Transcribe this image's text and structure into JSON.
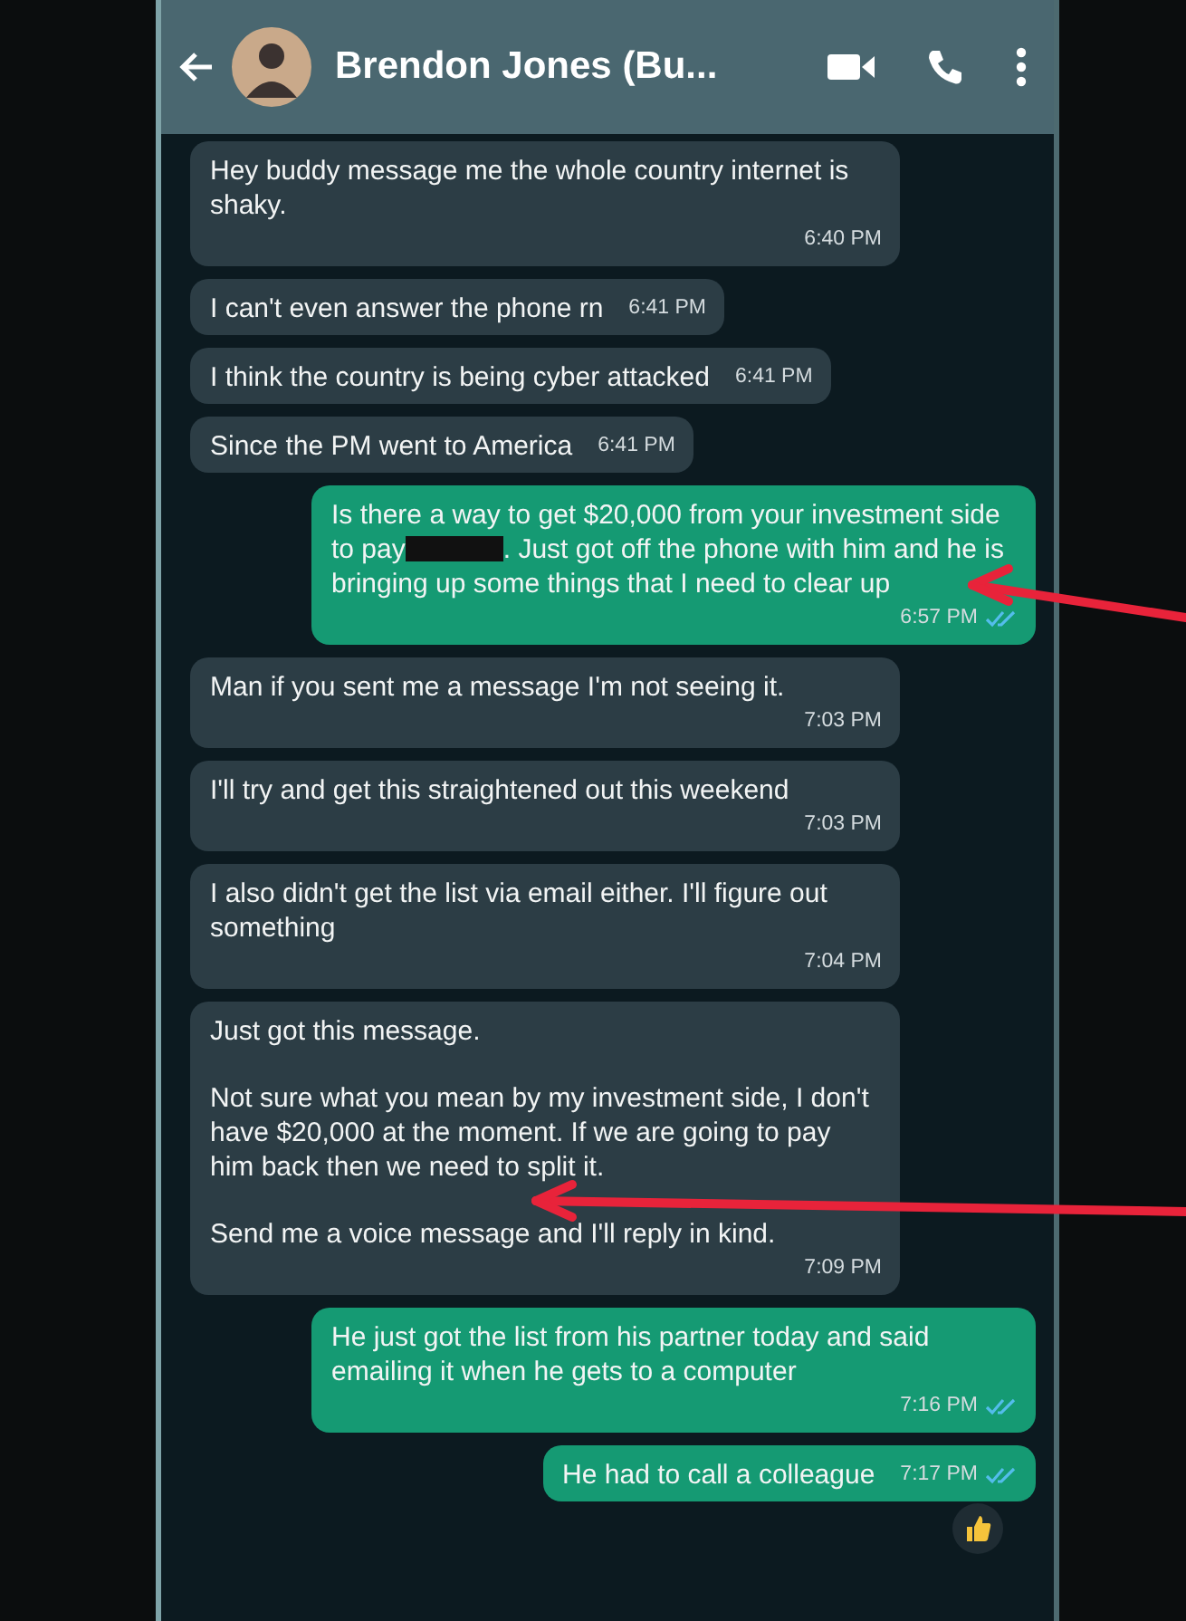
{
  "header": {
    "contact_name": "Brendon Jones (Bu..."
  },
  "messages": [
    {
      "kind": "incoming",
      "parts": [
        {
          "kind": "text",
          "text": "Hey buddy message me the whole country internet is shaky."
        }
      ],
      "time": "6:40 PM"
    },
    {
      "kind": "incoming",
      "parts": [
        {
          "kind": "text",
          "text": "I can't even answer the phone rn"
        }
      ],
      "time": "6:41 PM"
    },
    {
      "kind": "incoming",
      "parts": [
        {
          "kind": "text",
          "text": "I think the country is being cyber attacked"
        }
      ],
      "time": "6:41 PM"
    },
    {
      "kind": "incoming",
      "parts": [
        {
          "kind": "text",
          "text": "Since the PM went to America"
        }
      ],
      "time": "6:41 PM"
    },
    {
      "kind": "outgoing",
      "parts": [
        {
          "kind": "text",
          "text": "Is there a way to get $20,000 from your investment side to pay"
        },
        {
          "kind": "redacted"
        },
        {
          "kind": "text",
          "text": ". Just got off the phone with him and he is bringing up some things that I need to clear up"
        }
      ],
      "time": "6:57 PM",
      "read": true
    },
    {
      "kind": "incoming",
      "parts": [
        {
          "kind": "text",
          "text": "Man if you sent me a message I'm not seeing it."
        }
      ],
      "time": "7:03 PM"
    },
    {
      "kind": "incoming",
      "parts": [
        {
          "kind": "text",
          "text": "I'll try and get this straightened out this weekend"
        }
      ],
      "time": "7:03 PM"
    },
    {
      "kind": "incoming",
      "parts": [
        {
          "kind": "text",
          "text": "I also didn't get the list via email either. I'll figure out something"
        }
      ],
      "time": "7:04 PM"
    },
    {
      "kind": "incoming",
      "parts": [
        {
          "kind": "paragraph",
          "text": "Just got this message."
        },
        {
          "kind": "paragraph",
          "text": "Not sure what you mean by my investment side, I don't have $20,000 at the moment. If we are going to pay him back then we need to split it."
        },
        {
          "kind": "paragraph",
          "text": "Send me a voice message and I'll reply in kind."
        }
      ],
      "time": "7:09 PM"
    },
    {
      "kind": "outgoing",
      "parts": [
        {
          "kind": "text",
          "text": "He just got the list from his partner today and said emailing it when he gets to a computer"
        }
      ],
      "time": "7:16 PM",
      "read": true
    },
    {
      "kind": "outgoing",
      "parts": [
        {
          "kind": "text",
          "text": "He had to call a colleague"
        }
      ],
      "time": "7:17 PM",
      "read": true,
      "thumbs_up_reaction": true
    }
  ]
}
